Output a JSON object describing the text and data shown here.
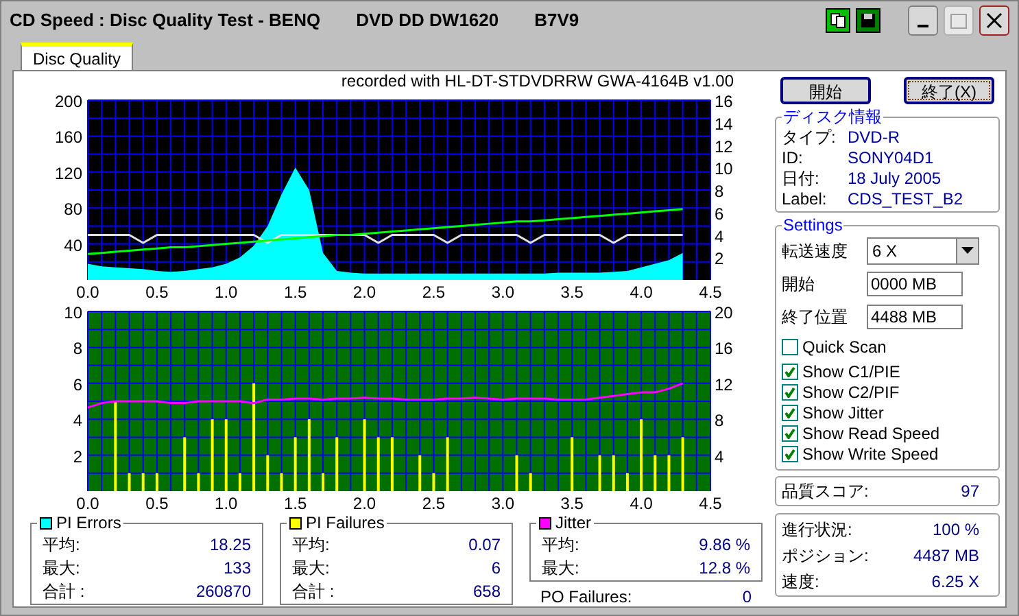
{
  "window": {
    "title_parts": [
      "CD Speed : Disc Quality Test - BENQ",
      "DVD DD DW1620",
      "B7V9"
    ]
  },
  "tabs": [
    {
      "label": "Disc Quality",
      "selected": true
    }
  ],
  "recorded_with": "recorded with HL-DT-STDVDRRW GWA-4164B v1.00",
  "charts": [
    {
      "chart_data": {
        "type": "area",
        "grid": true,
        "xlim": [
          0,
          4.5
        ],
        "ylim": [
          0,
          200
        ],
        "y2lim": [
          0,
          16
        ],
        "x": [
          0,
          0.1,
          0.2,
          0.3,
          0.4,
          0.5,
          0.6,
          0.7,
          0.8,
          0.9,
          1,
          1.1,
          1.2,
          1.3,
          1.4,
          1.5,
          1.6,
          1.7,
          1.8,
          1.9,
          2,
          2.1,
          2.2,
          2.3,
          2.4,
          2.5,
          2.6,
          2.7,
          2.8,
          2.9,
          3,
          3.1,
          3.2,
          3.3,
          3.4,
          3.5,
          3.6,
          3.7,
          3.8,
          3.9,
          4,
          4.1,
          4.2,
          4.3
        ],
        "xticks": [
          {
            "value": 0,
            "label": "0.0"
          },
          {
            "value": 0.5,
            "label": "0.5"
          },
          {
            "value": 1,
            "label": "1.0"
          },
          {
            "value": 1.5,
            "label": "1.5"
          },
          {
            "value": 2,
            "label": "2.0"
          },
          {
            "value": 2.5,
            "label": "2.5"
          },
          {
            "value": 3,
            "label": "3.0"
          },
          {
            "value": 3.5,
            "label": "3.5"
          },
          {
            "value": 4,
            "label": "4.0"
          },
          {
            "value": 4.5,
            "label": "4.5"
          }
        ],
        "yticks": [
          40,
          80,
          120,
          160,
          200
        ],
        "y2ticks": [
          2,
          4,
          6,
          8,
          10,
          12,
          14,
          16
        ],
        "series": [
          {
            "color": "#00ffff",
            "values": [
              18,
              15,
              14,
              13,
              12,
              10,
              9,
              10,
              12,
              14,
              18,
              25,
              38,
              60,
              95,
              125,
              100,
              30,
              10,
              8,
              7,
              7,
              7,
              7,
              7,
              7,
              7,
              7,
              7,
              7,
              7,
              7,
              7,
              7,
              8,
              8,
              8,
              8,
              9,
              10,
              14,
              18,
              22,
              30
            ]
          },
          {
            "type": "line",
            "axis": "y2",
            "color": "#e0e0e0",
            "values": [
              4,
              4,
              4,
              4,
              3.3,
              4,
              4,
              4,
              4,
              4,
              4,
              4,
              4,
              3.3,
              4,
              4,
              4,
              4,
              4,
              4,
              4,
              3.3,
              4,
              4,
              4,
              4,
              3.3,
              4,
              4,
              4,
              4,
              4,
              3.3,
              4,
              4,
              4,
              4,
              4,
              3.3,
              4,
              4,
              4,
              4,
              4
            ]
          },
          {
            "type": "line",
            "axis": "y2",
            "color": "#00ff00",
            "values": [
              2.3,
              2.4,
              2.5,
              2.6,
              2.7,
              2.8,
              2.9,
              2.9,
              3.0,
              3.1,
              3.2,
              3.3,
              3.4,
              3.5,
              3.6,
              3.7,
              3.8,
              3.9,
              4.0,
              4.0,
              4.1,
              4.2,
              4.3,
              4.4,
              4.5,
              4.6,
              4.7,
              4.8,
              4.9,
              5.0,
              5.1,
              5.2,
              5.2,
              5.3,
              5.4,
              5.5,
              5.6,
              5.7,
              5.8,
              5.9,
              6.0,
              6.1,
              6.2,
              6.3
            ]
          }
        ]
      }
    },
    {
      "chart_data": {
        "type": "bar",
        "grid": true,
        "xlim": [
          0,
          4.5
        ],
        "ylim": [
          0,
          10
        ],
        "y2lim": [
          0,
          20
        ],
        "x": [
          0,
          0.1,
          0.2,
          0.3,
          0.4,
          0.5,
          0.6,
          0.7,
          0.8,
          0.9,
          1,
          1.1,
          1.2,
          1.3,
          1.4,
          1.5,
          1.6,
          1.7,
          1.8,
          1.9,
          2,
          2.1,
          2.2,
          2.3,
          2.4,
          2.5,
          2.6,
          2.7,
          2.8,
          2.9,
          3,
          3.1,
          3.2,
          3.3,
          3.4,
          3.5,
          3.6,
          3.7,
          3.8,
          3.9,
          4,
          4.1,
          4.2,
          4.3
        ],
        "xticks": [
          {
            "value": 0,
            "label": "0.0"
          },
          {
            "value": 0.5,
            "label": "0.5"
          },
          {
            "value": 1,
            "label": "1.0"
          },
          {
            "value": 1.5,
            "label": "1.5"
          },
          {
            "value": 2,
            "label": "2.0"
          },
          {
            "value": 2.5,
            "label": "2.5"
          },
          {
            "value": 3,
            "label": "3.0"
          },
          {
            "value": 3.5,
            "label": "3.5"
          },
          {
            "value": 4,
            "label": "4.0"
          },
          {
            "value": 4.5,
            "label": "4.5"
          }
        ],
        "yticks": [
          2,
          4,
          6,
          8,
          10
        ],
        "y2ticks": [
          4,
          8,
          12,
          16,
          20
        ],
        "series": [
          {
            "color": "#ffff00",
            "values": [
              0,
              0,
              5,
              1,
              1,
              1,
              0,
              3,
              1,
              4,
              4,
              1,
              6,
              2,
              1,
              3,
              4,
              1,
              3,
              0,
              4,
              3,
              3,
              0,
              2,
              1,
              3,
              0,
              0,
              0,
              0,
              2,
              1,
              0,
              0,
              3,
              0,
              2,
              2,
              1,
              4,
              2,
              2,
              3
            ]
          },
          {
            "type": "line",
            "axis": "y2",
            "color": "#ff00ff",
            "values": [
              9.3,
              9.8,
              10.0,
              10.0,
              10.0,
              10.0,
              9.8,
              9.8,
              10.0,
              10.0,
              10.0,
              10.0,
              9.8,
              10.2,
              10.2,
              10.3,
              10.3,
              10.2,
              10.3,
              10.3,
              10.4,
              10.3,
              10.3,
              10.2,
              10.2,
              10.2,
              10.3,
              10.3,
              10.4,
              10.3,
              10.2,
              10.3,
              10.3,
              10.3,
              10.2,
              10.2,
              10.2,
              10.4,
              10.6,
              10.8,
              11.0,
              11.0,
              11.4,
              12.0
            ]
          }
        ]
      }
    }
  ],
  "stats": [
    {
      "title": "PI Errors",
      "color": "#00ffff",
      "rows": [
        {
          "label": "平均:",
          "value": "18.25"
        },
        {
          "label": "最大:",
          "value": "133"
        },
        {
          "label": "合計 :",
          "value": "260870"
        }
      ]
    },
    {
      "title": "PI Failures",
      "color": "#ffff00",
      "rows": [
        {
          "label": "平均:",
          "value": "0.07"
        },
        {
          "label": "最大:",
          "value": "6"
        },
        {
          "label": "合計 :",
          "value": "658"
        }
      ]
    },
    {
      "title": "Jitter",
      "color": "#ff00ff",
      "rows": [
        {
          "label": "平均:",
          "value": "9.86 %"
        },
        {
          "label": "最大:",
          "value": "12.8 %"
        }
      ]
    }
  ],
  "po_failures": {
    "label": "PO Failures:",
    "value": "0"
  },
  "buttons": [
    {
      "label": "開始",
      "focused": false
    },
    {
      "label": "終了(X)",
      "focused": true
    }
  ],
  "disc_info": {
    "title": "ディスク情報",
    "rows": [
      {
        "label": "タイプ:",
        "value": "DVD-R"
      },
      {
        "label": "ID:",
        "value": "SONY04D1"
      },
      {
        "label": "日付:",
        "value": "18 July 2005"
      },
      {
        "label": "Label:",
        "value": "CDS_TEST_B2"
      }
    ]
  },
  "settings": {
    "title": "Settings",
    "speed": {
      "label": "転送速度",
      "value": "6 X"
    },
    "start": {
      "label": "開始",
      "value": "0000 MB"
    },
    "end": {
      "label": "終了位置",
      "value": "4488 MB"
    },
    "checkboxes": [
      {
        "label": "Quick Scan",
        "checked": false
      },
      {
        "label": "Show C1/PIE",
        "checked": true
      },
      {
        "label": "Show C2/PIF",
        "checked": true
      },
      {
        "label": "Show Jitter",
        "checked": true
      },
      {
        "label": "Show Read Speed",
        "checked": true
      },
      {
        "label": "Show Write Speed",
        "checked": true
      }
    ]
  },
  "quality_score": {
    "label": "品質スコア:",
    "value": "97"
  },
  "progress": [
    {
      "label": "進行状況:",
      "value": "100 %"
    },
    {
      "label": "ポジション:",
      "value": "4487 MB"
    },
    {
      "label": "速度:",
      "value": "6.25 X"
    }
  ]
}
